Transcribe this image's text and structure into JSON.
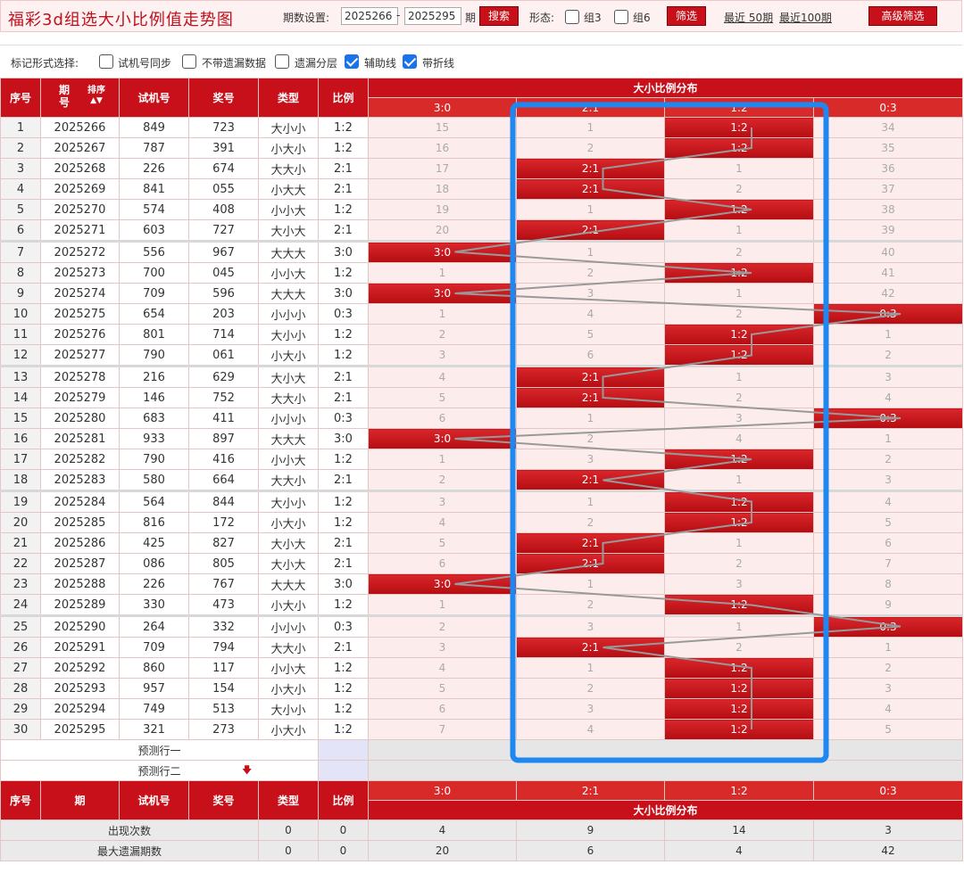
{
  "header": {
    "title": "福彩3d组选大小比例值走势图",
    "period_label": "期数设置:",
    "period_from": "2025266",
    "period_dash": "-",
    "period_to": "2025295",
    "period_unit": "期",
    "search_label": "搜索",
    "form_label": "形态:",
    "group3_label": "组3",
    "group6_label": "组6",
    "filter_label": "筛选",
    "recent50_label": "最近 50期",
    "recent100_label": "最近100期",
    "advanced_label": "高级筛选"
  },
  "marks": {
    "label": "标记形式选择:",
    "options": [
      {
        "label": "试机号同步",
        "checked": false
      },
      {
        "label": "不带遗漏数据",
        "checked": false
      },
      {
        "label": "遗漏分层",
        "checked": false
      },
      {
        "label": "辅助线",
        "checked": true
      },
      {
        "label": "带折线",
        "checked": true
      }
    ]
  },
  "table": {
    "columns": {
      "seq": "序号",
      "period_top": "期",
      "period_bottom": "号",
      "sort": "排序",
      "trial": "试机号",
      "prize": "奖号",
      "type": "类型",
      "ratio": "比例"
    },
    "dist_title": "大小比例分布",
    "dist_labels": [
      "3:0",
      "2:1",
      "1:2",
      "0:3"
    ],
    "rows": [
      {
        "seq": "1",
        "period": "2025266",
        "trial": "849",
        "prize": "723",
        "type": "大小小",
        "ratio": "1:2",
        "hit": 2,
        "miss": [
          "15",
          "1",
          "",
          "34"
        ]
      },
      {
        "seq": "2",
        "period": "2025267",
        "trial": "787",
        "prize": "391",
        "type": "小大小",
        "ratio": "1:2",
        "hit": 2,
        "miss": [
          "16",
          "2",
          "",
          "35"
        ]
      },
      {
        "seq": "3",
        "period": "2025268",
        "trial": "226",
        "prize": "674",
        "type": "大大小",
        "ratio": "2:1",
        "hit": 1,
        "miss": [
          "17",
          "",
          "1",
          "36"
        ]
      },
      {
        "seq": "4",
        "period": "2025269",
        "trial": "841",
        "prize": "055",
        "type": "小大大",
        "ratio": "2:1",
        "hit": 1,
        "miss": [
          "18",
          "",
          "2",
          "37"
        ]
      },
      {
        "seq": "5",
        "period": "2025270",
        "trial": "574",
        "prize": "408",
        "type": "小小大",
        "ratio": "1:2",
        "hit": 2,
        "miss": [
          "19",
          "1",
          "",
          "38"
        ]
      },
      {
        "seq": "6",
        "period": "2025271",
        "trial": "603",
        "prize": "727",
        "type": "大小大",
        "ratio": "2:1",
        "hit": 1,
        "miss": [
          "20",
          "",
          "1",
          "39"
        ]
      },
      {
        "seq": "7",
        "period": "2025272",
        "trial": "556",
        "prize": "967",
        "type": "大大大",
        "ratio": "3:0",
        "hit": 0,
        "miss": [
          "",
          "1",
          "2",
          "40"
        ]
      },
      {
        "seq": "8",
        "period": "2025273",
        "trial": "700",
        "prize": "045",
        "type": "小小大",
        "ratio": "1:2",
        "hit": 2,
        "miss": [
          "1",
          "2",
          "",
          "41"
        ]
      },
      {
        "seq": "9",
        "period": "2025274",
        "trial": "709",
        "prize": "596",
        "type": "大大大",
        "ratio": "3:0",
        "hit": 0,
        "miss": [
          "",
          "3",
          "1",
          "42"
        ]
      },
      {
        "seq": "10",
        "period": "2025275",
        "trial": "654",
        "prize": "203",
        "type": "小小小",
        "ratio": "0:3",
        "hit": 3,
        "miss": [
          "1",
          "4",
          "2",
          ""
        ]
      },
      {
        "seq": "11",
        "period": "2025276",
        "trial": "801",
        "prize": "714",
        "type": "大小小",
        "ratio": "1:2",
        "hit": 2,
        "miss": [
          "2",
          "5",
          "",
          "1"
        ]
      },
      {
        "seq": "12",
        "period": "2025277",
        "trial": "790",
        "prize": "061",
        "type": "小大小",
        "ratio": "1:2",
        "hit": 2,
        "miss": [
          "3",
          "6",
          "",
          "2"
        ]
      },
      {
        "seq": "13",
        "period": "2025278",
        "trial": "216",
        "prize": "629",
        "type": "大小大",
        "ratio": "2:1",
        "hit": 1,
        "miss": [
          "4",
          "",
          "1",
          "3"
        ]
      },
      {
        "seq": "14",
        "period": "2025279",
        "trial": "146",
        "prize": "752",
        "type": "大大小",
        "ratio": "2:1",
        "hit": 1,
        "miss": [
          "5",
          "",
          "2",
          "4"
        ]
      },
      {
        "seq": "15",
        "period": "2025280",
        "trial": "683",
        "prize": "411",
        "type": "小小小",
        "ratio": "0:3",
        "hit": 3,
        "miss": [
          "6",
          "1",
          "3",
          ""
        ]
      },
      {
        "seq": "16",
        "period": "2025281",
        "trial": "933",
        "prize": "897",
        "type": "大大大",
        "ratio": "3:0",
        "hit": 0,
        "miss": [
          "",
          "2",
          "4",
          "1"
        ]
      },
      {
        "seq": "17",
        "period": "2025282",
        "trial": "790",
        "prize": "416",
        "type": "小小大",
        "ratio": "1:2",
        "hit": 2,
        "miss": [
          "1",
          "3",
          "",
          "2"
        ]
      },
      {
        "seq": "18",
        "period": "2025283",
        "trial": "580",
        "prize": "664",
        "type": "大大小",
        "ratio": "2:1",
        "hit": 1,
        "miss": [
          "2",
          "",
          "1",
          "3"
        ]
      },
      {
        "seq": "19",
        "period": "2025284",
        "trial": "564",
        "prize": "844",
        "type": "大小小",
        "ratio": "1:2",
        "hit": 2,
        "miss": [
          "3",
          "1",
          "",
          "4"
        ]
      },
      {
        "seq": "20",
        "period": "2025285",
        "trial": "816",
        "prize": "172",
        "type": "小大小",
        "ratio": "1:2",
        "hit": 2,
        "miss": [
          "4",
          "2",
          "",
          "5"
        ]
      },
      {
        "seq": "21",
        "period": "2025286",
        "trial": "425",
        "prize": "827",
        "type": "大小大",
        "ratio": "2:1",
        "hit": 1,
        "miss": [
          "5",
          "",
          "1",
          "6"
        ]
      },
      {
        "seq": "22",
        "period": "2025287",
        "trial": "086",
        "prize": "805",
        "type": "大小大",
        "ratio": "2:1",
        "hit": 1,
        "miss": [
          "6",
          "",
          "2",
          "7"
        ]
      },
      {
        "seq": "23",
        "period": "2025288",
        "trial": "226",
        "prize": "767",
        "type": "大大大",
        "ratio": "3:0",
        "hit": 0,
        "miss": [
          "",
          "1",
          "3",
          "8"
        ]
      },
      {
        "seq": "24",
        "period": "2025289",
        "trial": "330",
        "prize": "473",
        "type": "小大小",
        "ratio": "1:2",
        "hit": 2,
        "miss": [
          "1",
          "2",
          "",
          "9"
        ]
      },
      {
        "seq": "25",
        "period": "2025290",
        "trial": "264",
        "prize": "332",
        "type": "小小小",
        "ratio": "0:3",
        "hit": 3,
        "miss": [
          "2",
          "3",
          "1",
          ""
        ]
      },
      {
        "seq": "26",
        "period": "2025291",
        "trial": "709",
        "prize": "794",
        "type": "大大小",
        "ratio": "2:1",
        "hit": 1,
        "miss": [
          "3",
          "",
          "2",
          "1"
        ]
      },
      {
        "seq": "27",
        "period": "2025292",
        "trial": "860",
        "prize": "117",
        "type": "小小大",
        "ratio": "1:2",
        "hit": 2,
        "miss": [
          "4",
          "1",
          "",
          "2"
        ]
      },
      {
        "seq": "28",
        "period": "2025293",
        "trial": "957",
        "prize": "154",
        "type": "小大小",
        "ratio": "1:2",
        "hit": 2,
        "miss": [
          "5",
          "2",
          "",
          "3"
        ]
      },
      {
        "seq": "29",
        "period": "2025294",
        "trial": "749",
        "prize": "513",
        "type": "大小小",
        "ratio": "1:2",
        "hit": 2,
        "miss": [
          "6",
          "3",
          "",
          "4"
        ]
      },
      {
        "seq": "30",
        "period": "2025295",
        "trial": "321",
        "prize": "273",
        "type": "小大小",
        "ratio": "1:2",
        "hit": 2,
        "miss": [
          "7",
          "4",
          "",
          "5"
        ]
      }
    ],
    "predict_row_1": "预测行一",
    "predict_row_2": "预测行二",
    "stats": [
      {
        "label": "出现次数",
        "type": "0",
        "ratio": "0",
        "values": [
          "4",
          "9",
          "14",
          "3"
        ]
      },
      {
        "label": "最大遗漏期数",
        "type": "0",
        "ratio": "0",
        "values": [
          "20",
          "6",
          "4",
          "42"
        ]
      }
    ]
  },
  "colors": {
    "brand_red": "#c8101a",
    "highlight_blue": "#1e88f0",
    "trend_line": "#999999"
  },
  "icons": {
    "sort": "sort-arrows-icon",
    "predict_arrow": "arrow-down-icon"
  }
}
